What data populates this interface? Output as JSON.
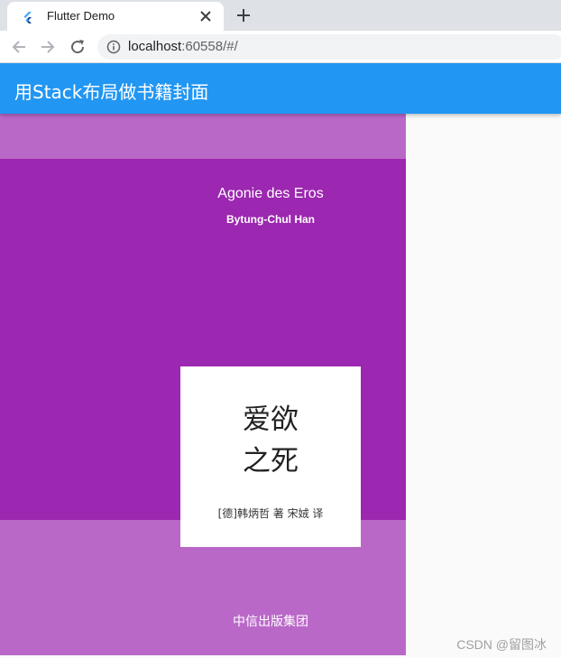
{
  "browser": {
    "tab_title": "Flutter Demo",
    "url_host": "localhost",
    "url_rest": ":60558/#/"
  },
  "app": {
    "title": "用Stack布局做书籍封面",
    "colors": {
      "appbar": "#2196f3",
      "cover_light": "#ba68c8",
      "cover_dark": "#9c27b0",
      "card": "#ffffff"
    }
  },
  "cover": {
    "en_title": "Agonie des Eros",
    "en_author": "Bytung-Chul Han",
    "cn_title_line1": "爱欲",
    "cn_title_line2": "之死",
    "cn_author": "[德]韩炳哲 著 宋娀 译",
    "publisher": "中信出版集团"
  },
  "watermark": "CSDN @留图冰"
}
